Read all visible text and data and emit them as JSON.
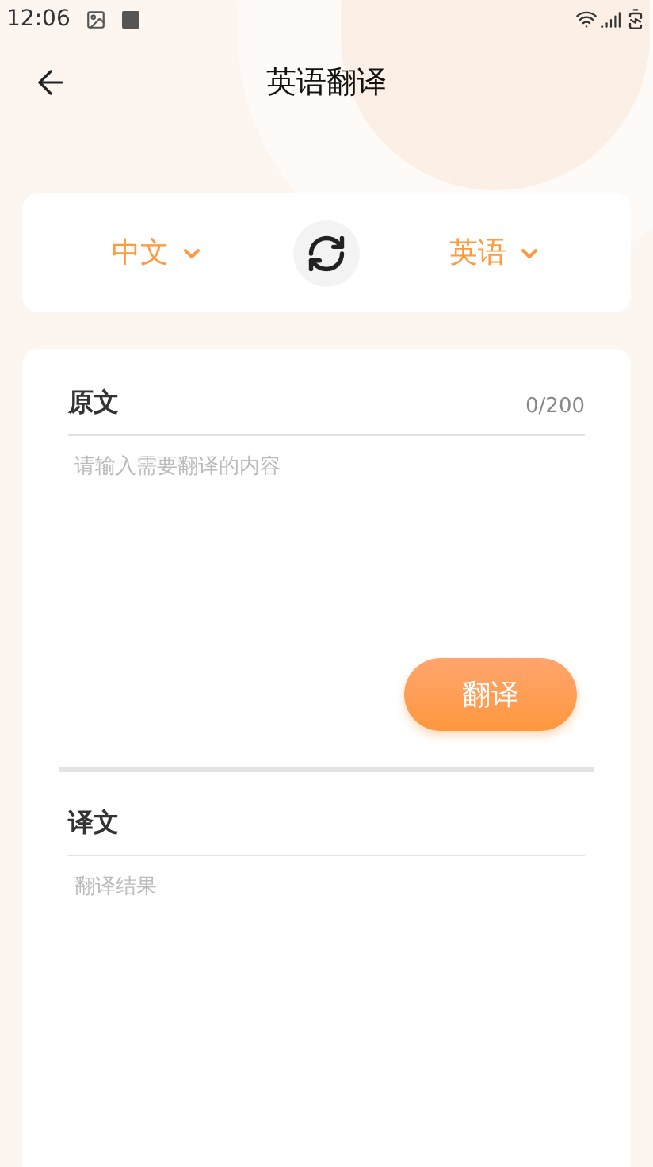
{
  "status_bar": {
    "time": "12:06"
  },
  "header": {
    "title": "英语翻译"
  },
  "languages": {
    "source": "中文",
    "target": "英语"
  },
  "source": {
    "label": "原文",
    "count": "0/200",
    "placeholder": "请输入需要翻译的内容",
    "button": "翻译"
  },
  "result": {
    "label": "译文",
    "placeholder": "翻译结果"
  }
}
